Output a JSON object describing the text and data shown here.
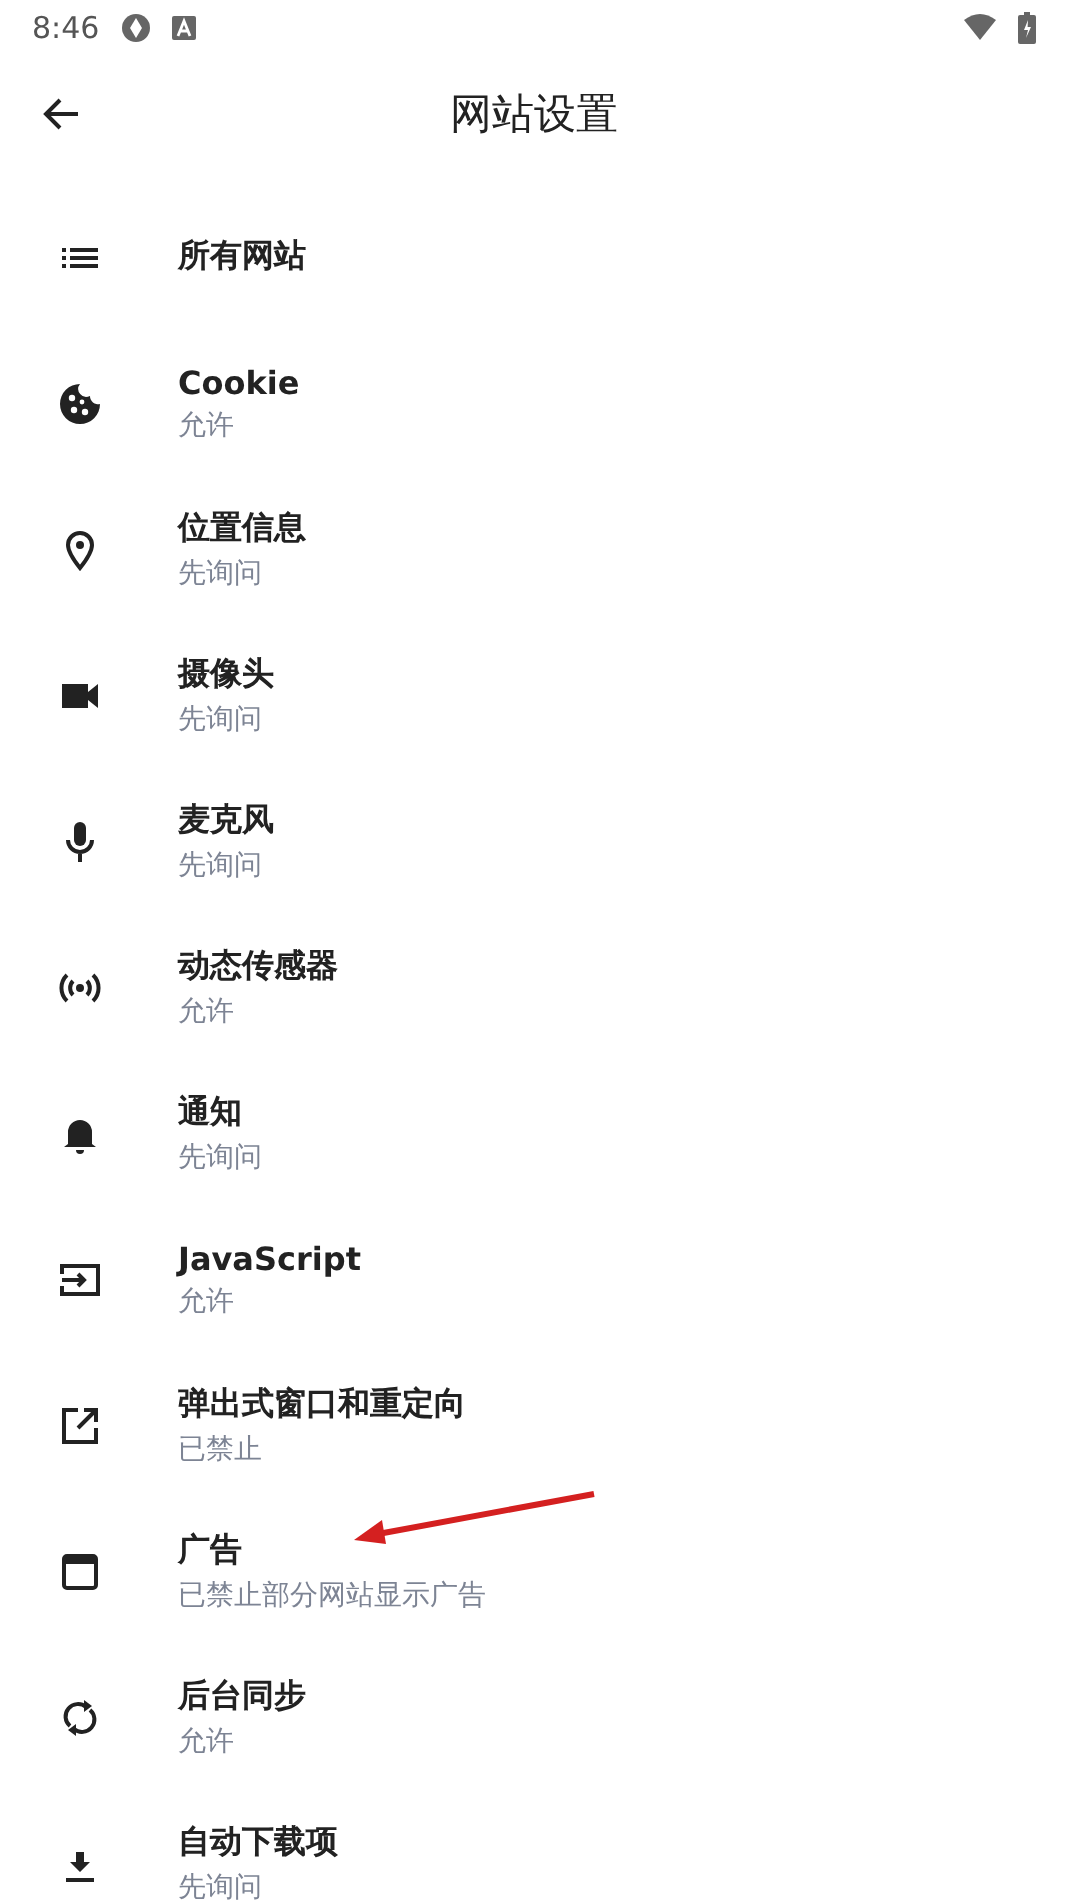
{
  "status_bar": {
    "time": "8:46"
  },
  "app_bar": {
    "title": "网站设置"
  },
  "settings": [
    {
      "kind": "list",
      "title": "所有网站"
    },
    {
      "kind": "cookie",
      "title": "Cookie",
      "summary": "允许"
    },
    {
      "kind": "location",
      "title": "位置信息",
      "summary": "先询问"
    },
    {
      "kind": "camera",
      "title": "摄像头",
      "summary": "先询问"
    },
    {
      "kind": "mic",
      "title": "麦克风",
      "summary": "先询问"
    },
    {
      "kind": "sensors",
      "title": "动态传感器",
      "summary": "允许"
    },
    {
      "kind": "bell",
      "title": "通知",
      "summary": "先询问"
    },
    {
      "kind": "script",
      "title": "JavaScript",
      "summary": "允许"
    },
    {
      "kind": "popup",
      "title": "弹出式窗口和重定向",
      "summary": "已禁止"
    },
    {
      "kind": "ads",
      "title": "广告",
      "summary": "已禁止部分网站显示广告"
    },
    {
      "kind": "sync",
      "title": "后台同步",
      "summary": "允许"
    },
    {
      "kind": "download",
      "title": "自动下载项",
      "summary": "先询问"
    }
  ]
}
